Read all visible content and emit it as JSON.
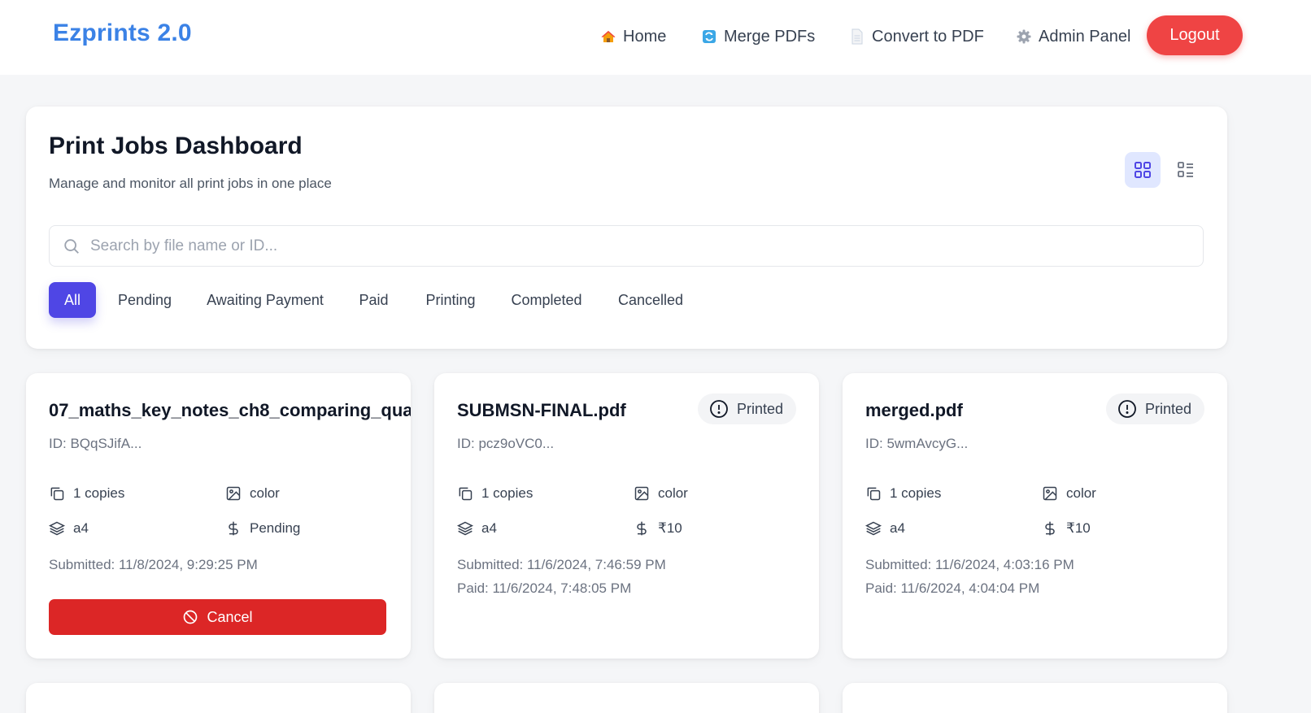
{
  "nav": {
    "brand": "Ezprints 2.0",
    "links": [
      {
        "label": "Home",
        "icon": "house-icon"
      },
      {
        "label": "Merge PDFs",
        "icon": "merge-icon"
      },
      {
        "label": "Convert to PDF",
        "icon": "document-icon"
      },
      {
        "label": "Admin Panel",
        "icon": "gear-icon"
      }
    ],
    "logout_label": "Logout"
  },
  "dashboard": {
    "title": "Print Jobs Dashboard",
    "subtitle": "Manage and monitor all print jobs in one place",
    "search_placeholder": "Search by file name or ID...",
    "search_value": "",
    "view_modes": [
      "grid",
      "list"
    ],
    "active_view": "grid",
    "filters": [
      "All",
      "Pending",
      "Awaiting Payment",
      "Paid",
      "Printing",
      "Completed",
      "Cancelled"
    ],
    "active_filter": "All"
  },
  "jobs": [
    {
      "title": "07_maths_key_notes_ch8_comparing_qua",
      "id": "ID: BQqSJifA...",
      "status": "",
      "copies": "1 copies",
      "color": "color",
      "size": "a4",
      "price": "Pending",
      "submitted": "Submitted: 11/8/2024, 9:29:25 PM",
      "paid": "",
      "action": "Cancel"
    },
    {
      "title": "SUBMSN-FINAL.pdf",
      "id": "ID: pcz9oVC0...",
      "status": "Printed",
      "copies": "1 copies",
      "color": "color",
      "size": "a4",
      "price": "₹10",
      "submitted": "Submitted: 11/6/2024, 7:46:59 PM",
      "paid": "Paid: 11/6/2024, 7:48:05 PM",
      "action": ""
    },
    {
      "title": "merged.pdf",
      "id": "ID: 5wmAvcyG...",
      "status": "Printed",
      "copies": "1 copies",
      "color": "color",
      "size": "a4",
      "price": "₹10",
      "submitted": "Submitted: 11/6/2024, 4:03:16 PM",
      "paid": "Paid: 11/6/2024, 4:04:04 PM",
      "action": ""
    }
  ],
  "colors": {
    "brand": "#3b82e6",
    "logout": "#ef4444",
    "active_filter": "#4f46e5",
    "cancel": "#dc2626"
  }
}
